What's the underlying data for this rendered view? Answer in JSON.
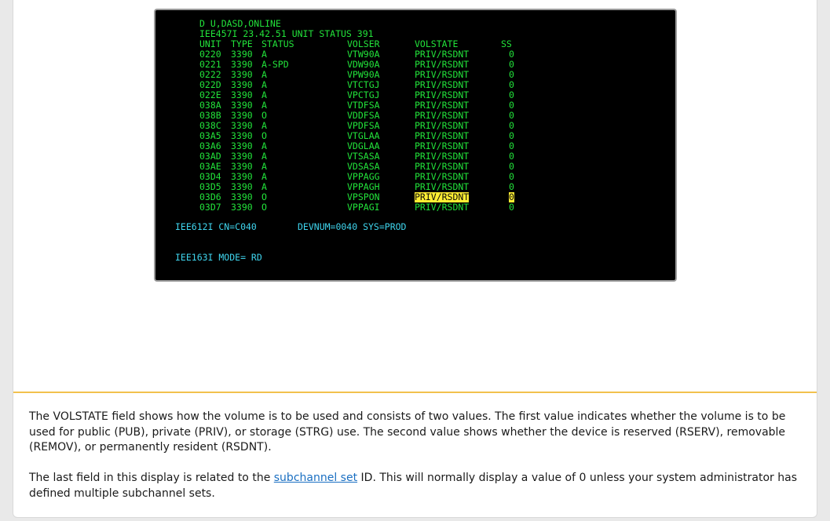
{
  "terminal": {
    "command": "D U,DASD,ONLINE",
    "status_line": "IEE457I 23.42.51 UNIT STATUS 391",
    "headers": {
      "unit": "UNIT",
      "type": "TYPE",
      "status": "STATUS",
      "volser": "VOLSER",
      "volstate": "VOLSTATE",
      "ss": "SS"
    },
    "rows": [
      {
        "unit": "0220",
        "type": "3390",
        "status": "A",
        "volser": "VTW90A",
        "volstate": "PRIV/RSDNT",
        "ss": "0"
      },
      {
        "unit": "0221",
        "type": "3390",
        "status": "A-SPD",
        "volser": "VDW90A",
        "volstate": "PRIV/RSDNT",
        "ss": "0"
      },
      {
        "unit": "0222",
        "type": "3390",
        "status": "A",
        "volser": "VPW90A",
        "volstate": "PRIV/RSDNT",
        "ss": "0"
      },
      {
        "unit": "022D",
        "type": "3390",
        "status": "A",
        "volser": "VTCTGJ",
        "volstate": "PRIV/RSDNT",
        "ss": "0"
      },
      {
        "unit": "022E",
        "type": "3390",
        "status": "A",
        "volser": "VPCTGJ",
        "volstate": "PRIV/RSDNT",
        "ss": "0"
      },
      {
        "unit": "038A",
        "type": "3390",
        "status": "A",
        "volser": "VTDFSA",
        "volstate": "PRIV/RSDNT",
        "ss": "0"
      },
      {
        "unit": "038B",
        "type": "3390",
        "status": "O",
        "volser": "VDDFSA",
        "volstate": "PRIV/RSDNT",
        "ss": "0"
      },
      {
        "unit": "038C",
        "type": "3390",
        "status": "A",
        "volser": "VPDFSA",
        "volstate": "PRIV/RSDNT",
        "ss": "0"
      },
      {
        "unit": "03A5",
        "type": "3390",
        "status": "O",
        "volser": "VTGLAA",
        "volstate": "PRIV/RSDNT",
        "ss": "0"
      },
      {
        "unit": "03A6",
        "type": "3390",
        "status": "A",
        "volser": "VDGLAA",
        "volstate": "PRIV/RSDNT",
        "ss": "0"
      },
      {
        "unit": "03AD",
        "type": "3390",
        "status": "A",
        "volser": "VTSASA",
        "volstate": "PRIV/RSDNT",
        "ss": "0"
      },
      {
        "unit": "03AE",
        "type": "3390",
        "status": "A",
        "volser": "VDSASA",
        "volstate": "PRIV/RSDNT",
        "ss": "0"
      },
      {
        "unit": "03D4",
        "type": "3390",
        "status": "A",
        "volser": "VPPAGG",
        "volstate": "PRIV/RSDNT",
        "ss": "0"
      },
      {
        "unit": "03D5",
        "type": "3390",
        "status": "A",
        "volser": "VPPAGH",
        "volstate": "PRIV/RSDNT",
        "ss": "0"
      },
      {
        "unit": "03D6",
        "type": "3390",
        "status": "O",
        "volser": "VPSPON",
        "volstate": "PRIV/RSDNT",
        "ss": "0",
        "highlighted": true
      },
      {
        "unit": "03D7",
        "type": "3390",
        "status": "O",
        "volser": "VPPAGI",
        "volstate": "PRIV/RSDNT",
        "ss": "0"
      }
    ],
    "console_id": "IEE612I CN=C040",
    "devnum": "DEVNUM=0040 SYS=PROD",
    "mode_line": "IEE163I MODE= RD"
  },
  "paragraph1": "The VOLSTATE field shows how the volume is to be used and consists of two values. The first value indicates whether the volume is to be used for public (PUB), private (PRIV), or storage (STRG) use. The second value shows whether the device is reserved (RSERV), removable (REMOV), or permanently resident (RSDNT).",
  "paragraph2": {
    "before": "The last field in this display is related to the ",
    "link": "subchannel set",
    "after": " ID. This will normally display a value of 0 unless your system administrator has defined multiple subchannel sets."
  },
  "colors": {
    "terminal_text": "#22e23a",
    "terminal_cyan": "#3fd5ee",
    "highlight": "#ffee33",
    "divider": "#f2c14e",
    "link": "#1a6fc2"
  }
}
